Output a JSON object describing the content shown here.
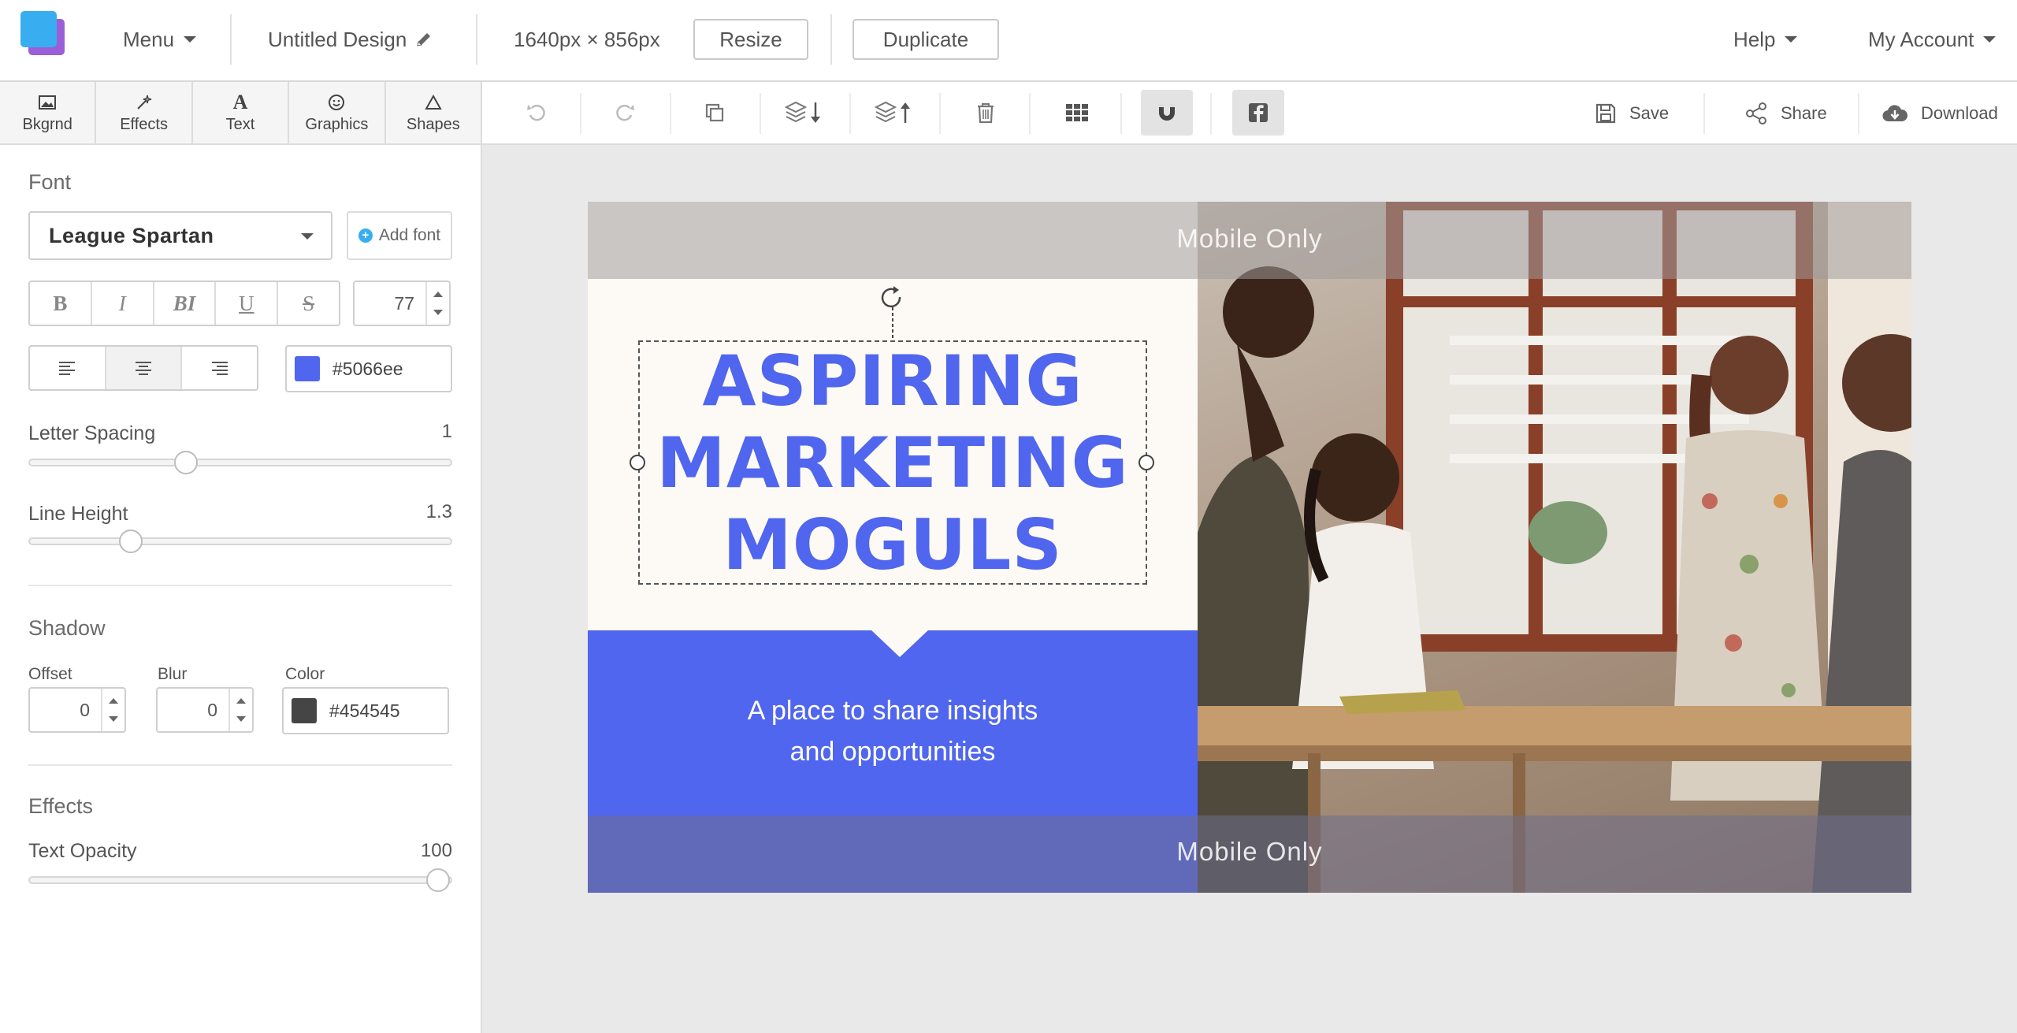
{
  "app": {
    "menu_label": "Menu",
    "design_title": "Untitled Design",
    "dimensions": "1640px × 856px",
    "resize_label": "Resize",
    "duplicate_label": "Duplicate",
    "help_label": "Help",
    "account_label": "My Account"
  },
  "tabs": [
    {
      "label": "Bkgrnd",
      "icon": "image-icon"
    },
    {
      "label": "Effects",
      "icon": "magic-wand-icon"
    },
    {
      "label": "Text",
      "icon": "text-icon"
    },
    {
      "label": "Graphics",
      "icon": "smiley-icon"
    },
    {
      "label": "Shapes",
      "icon": "triangle-icon"
    }
  ],
  "font_panel": {
    "section_title": "Font",
    "font_name": "League Spartan",
    "add_font_label": "Add font",
    "style_buttons": [
      "B",
      "I",
      "BI",
      "U",
      "S"
    ],
    "font_size": "77",
    "text_color_hex": "#5066ee",
    "text_color": "#5066ee",
    "letter_spacing_label": "Letter Spacing",
    "letter_spacing_value": "1",
    "letter_spacing_level": 0.37,
    "line_height_label": "Line Height",
    "line_height_value": "1.3",
    "line_height_level": 0.24
  },
  "shadow_panel": {
    "section_title": "Shadow",
    "offset_label": "Offset",
    "offset_value": "0",
    "blur_label": "Blur",
    "blur_value": "0",
    "color_label": "Color",
    "color_hex": "#454545",
    "color": "#454545"
  },
  "effects_panel": {
    "section_title": "Effects",
    "opacity_label": "Text Opacity",
    "opacity_value": "100",
    "opacity_level": 0.97
  },
  "toolbar": {
    "tools": [
      "undo-icon",
      "redo-icon",
      "copy-icon",
      "layer-down-icon",
      "layer-up-icon",
      "trash-icon",
      "grid-icon",
      "magnet-icon",
      "facebook-icon"
    ],
    "save_label": "Save",
    "share_label": "Share",
    "download_label": "Download"
  },
  "design": {
    "mobile_top": "Mobile Only",
    "mobile_bottom": "Mobile Only",
    "headline": [
      "ASPIRING",
      "MARKETING",
      "MOGULS"
    ],
    "subline": [
      "A place to share insights",
      "and opportunities"
    ],
    "accent_color": "#5066ee"
  }
}
